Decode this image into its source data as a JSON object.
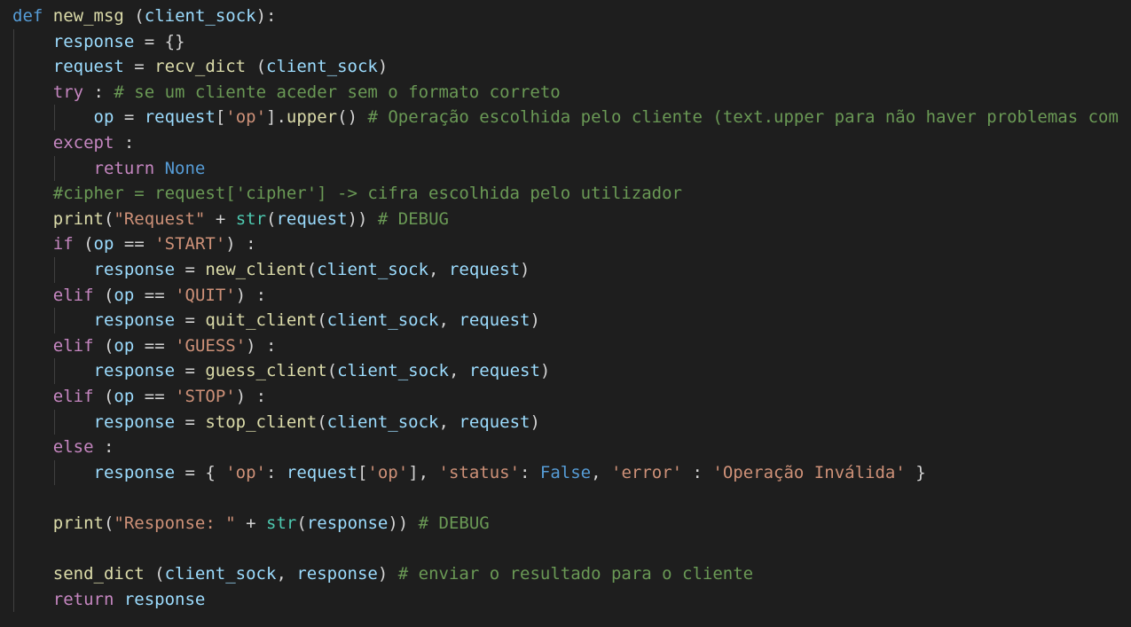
{
  "editor": {
    "language": "python",
    "theme_colors": {
      "background": "#1e1e1e",
      "keyword": "#569cd6",
      "control": "#c586c0",
      "function": "#dcdcaa",
      "variable": "#9cdcfe",
      "string": "#ce9178",
      "comment": "#6a9955",
      "builtin": "#4ec9b0",
      "default": "#d4d4d4"
    },
    "lines": [
      {
        "indent": 0,
        "tokens": [
          [
            "k",
            "def"
          ],
          [
            "p",
            " "
          ],
          [
            "f",
            "new_msg"
          ],
          [
            "p",
            " ("
          ],
          [
            "v",
            "client_sock"
          ],
          [
            "p",
            "):"
          ]
        ]
      },
      {
        "indent": 1,
        "tokens": [
          [
            "v",
            "response"
          ],
          [
            "p",
            " = {}"
          ]
        ]
      },
      {
        "indent": 1,
        "tokens": [
          [
            "v",
            "request"
          ],
          [
            "p",
            " = "
          ],
          [
            "f",
            "recv_dict"
          ],
          [
            "p",
            " ("
          ],
          [
            "v",
            "client_sock"
          ],
          [
            "p",
            ")"
          ]
        ]
      },
      {
        "indent": 1,
        "tokens": [
          [
            "c",
            "try"
          ],
          [
            "p",
            " : "
          ],
          [
            "m",
            "# se um cliente aceder sem o formato correto"
          ]
        ]
      },
      {
        "indent": 2,
        "tokens": [
          [
            "v",
            "op"
          ],
          [
            "p",
            " = "
          ],
          [
            "v",
            "request"
          ],
          [
            "p",
            "["
          ],
          [
            "s",
            "'op'"
          ],
          [
            "p",
            "]."
          ],
          [
            "f",
            "upper"
          ],
          [
            "p",
            "() "
          ],
          [
            "m",
            "# Operação escolhida pelo cliente (text.upper para não haver problemas com"
          ]
        ]
      },
      {
        "indent": 1,
        "tokens": [
          [
            "c",
            "except"
          ],
          [
            "p",
            " :"
          ]
        ]
      },
      {
        "indent": 2,
        "tokens": [
          [
            "c",
            "return"
          ],
          [
            "p",
            " "
          ],
          [
            "k",
            "None"
          ]
        ]
      },
      {
        "indent": 1,
        "tokens": [
          [
            "m",
            "#cipher = request['cipher'] -> cifra escolhida pelo utilizador"
          ]
        ]
      },
      {
        "indent": 1,
        "tokens": [
          [
            "f",
            "print"
          ],
          [
            "p",
            "("
          ],
          [
            "s",
            "\"Request\""
          ],
          [
            "p",
            " + "
          ],
          [
            "b",
            "str"
          ],
          [
            "p",
            "("
          ],
          [
            "v",
            "request"
          ],
          [
            "p",
            ")) "
          ],
          [
            "m",
            "# DEBUG"
          ]
        ]
      },
      {
        "indent": 1,
        "tokens": [
          [
            "c",
            "if"
          ],
          [
            "p",
            " ("
          ],
          [
            "v",
            "op"
          ],
          [
            "p",
            " == "
          ],
          [
            "s",
            "'START'"
          ],
          [
            "p",
            ") :"
          ]
        ]
      },
      {
        "indent": 2,
        "tokens": [
          [
            "v",
            "response"
          ],
          [
            "p",
            " = "
          ],
          [
            "f",
            "new_client"
          ],
          [
            "p",
            "("
          ],
          [
            "v",
            "client_sock"
          ],
          [
            "p",
            ", "
          ],
          [
            "v",
            "request"
          ],
          [
            "p",
            ")"
          ]
        ]
      },
      {
        "indent": 1,
        "tokens": [
          [
            "c",
            "elif"
          ],
          [
            "p",
            " ("
          ],
          [
            "v",
            "op"
          ],
          [
            "p",
            " == "
          ],
          [
            "s",
            "'QUIT'"
          ],
          [
            "p",
            ") :"
          ]
        ]
      },
      {
        "indent": 2,
        "tokens": [
          [
            "v",
            "response"
          ],
          [
            "p",
            " = "
          ],
          [
            "f",
            "quit_client"
          ],
          [
            "p",
            "("
          ],
          [
            "v",
            "client_sock"
          ],
          [
            "p",
            ", "
          ],
          [
            "v",
            "request"
          ],
          [
            "p",
            ")"
          ]
        ]
      },
      {
        "indent": 1,
        "tokens": [
          [
            "c",
            "elif"
          ],
          [
            "p",
            " ("
          ],
          [
            "v",
            "op"
          ],
          [
            "p",
            " == "
          ],
          [
            "s",
            "'GUESS'"
          ],
          [
            "p",
            ") :"
          ]
        ]
      },
      {
        "indent": 2,
        "tokens": [
          [
            "v",
            "response"
          ],
          [
            "p",
            " = "
          ],
          [
            "f",
            "guess_client"
          ],
          [
            "p",
            "("
          ],
          [
            "v",
            "client_sock"
          ],
          [
            "p",
            ", "
          ],
          [
            "v",
            "request"
          ],
          [
            "p",
            ")"
          ]
        ]
      },
      {
        "indent": 1,
        "tokens": [
          [
            "c",
            "elif"
          ],
          [
            "p",
            " ("
          ],
          [
            "v",
            "op"
          ],
          [
            "p",
            " == "
          ],
          [
            "s",
            "'STOP'"
          ],
          [
            "p",
            ") :"
          ]
        ]
      },
      {
        "indent": 2,
        "tokens": [
          [
            "v",
            "response"
          ],
          [
            "p",
            " = "
          ],
          [
            "f",
            "stop_client"
          ],
          [
            "p",
            "("
          ],
          [
            "v",
            "client_sock"
          ],
          [
            "p",
            ", "
          ],
          [
            "v",
            "request"
          ],
          [
            "p",
            ")"
          ]
        ]
      },
      {
        "indent": 1,
        "tokens": [
          [
            "c",
            "else"
          ],
          [
            "p",
            " :"
          ]
        ]
      },
      {
        "indent": 2,
        "tokens": [
          [
            "v",
            "response"
          ],
          [
            "p",
            " = { "
          ],
          [
            "s",
            "'op'"
          ],
          [
            "p",
            ": "
          ],
          [
            "v",
            "request"
          ],
          [
            "p",
            "["
          ],
          [
            "s",
            "'op'"
          ],
          [
            "p",
            "], "
          ],
          [
            "s",
            "'status'"
          ],
          [
            "p",
            ": "
          ],
          [
            "k",
            "False"
          ],
          [
            "p",
            ", "
          ],
          [
            "s",
            "'error'"
          ],
          [
            "p",
            " : "
          ],
          [
            "s",
            "'Operação Inválida'"
          ],
          [
            "p",
            " }"
          ]
        ]
      },
      {
        "indent": 1,
        "tokens": []
      },
      {
        "indent": 1,
        "tokens": [
          [
            "f",
            "print"
          ],
          [
            "p",
            "("
          ],
          [
            "s",
            "\"Response: \""
          ],
          [
            "p",
            " + "
          ],
          [
            "b",
            "str"
          ],
          [
            "p",
            "("
          ],
          [
            "v",
            "response"
          ],
          [
            "p",
            ")) "
          ],
          [
            "m",
            "# DEBUG"
          ]
        ]
      },
      {
        "indent": 1,
        "tokens": []
      },
      {
        "indent": 1,
        "tokens": [
          [
            "f",
            "send_dict"
          ],
          [
            "p",
            " ("
          ],
          [
            "v",
            "client_sock"
          ],
          [
            "p",
            ", "
          ],
          [
            "v",
            "response"
          ],
          [
            "p",
            ") "
          ],
          [
            "m",
            "# enviar o resultado para o cliente"
          ]
        ]
      },
      {
        "indent": 1,
        "tokens": [
          [
            "c",
            "return"
          ],
          [
            "p",
            " "
          ],
          [
            "v",
            "response"
          ]
        ]
      }
    ]
  }
}
